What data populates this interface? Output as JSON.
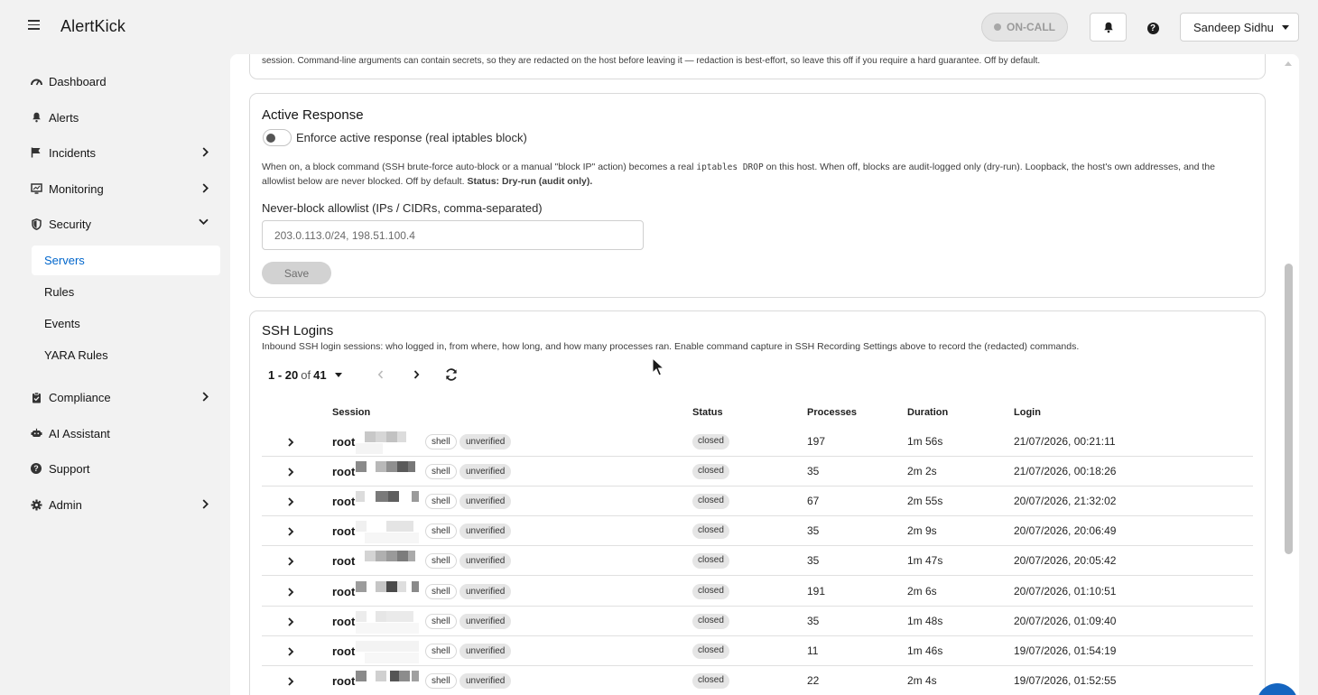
{
  "app": {
    "title": "AlertKick"
  },
  "header": {
    "oncall_label": "ON-CALL",
    "user_name": "Sandeep Sidhu",
    "icons": [
      "hamburger-menu-icon",
      "bell-icon",
      "help-icon",
      "caret-down-icon"
    ]
  },
  "sidebar": {
    "items": [
      {
        "label": "Dashboard",
        "icon": "dashboard-icon"
      },
      {
        "label": "Alerts",
        "icon": "bell-icon"
      },
      {
        "label": "Incidents",
        "icon": "flag-icon",
        "expandable": true
      },
      {
        "label": "Monitoring",
        "icon": "monitor-icon",
        "expandable": true
      },
      {
        "label": "Security",
        "icon": "shield-icon",
        "expanded": true
      },
      {
        "label": "Compliance",
        "icon": "clipboard-icon",
        "expandable": true
      },
      {
        "label": "AI Assistant",
        "icon": "robot-icon"
      },
      {
        "label": "Support",
        "icon": "question-icon"
      },
      {
        "label": "Admin",
        "icon": "gear-icon",
        "expandable": true
      }
    ],
    "security_sub": [
      {
        "label": "Servers",
        "active": true
      },
      {
        "label": "Rules"
      },
      {
        "label": "Events"
      },
      {
        "label": "YARA Rules"
      }
    ]
  },
  "top_note": "session. Command-line arguments can contain secrets, so they are redacted on the host before leaving it — redaction is best-effort, so leave this off if you require a hard guarantee. Off by default.",
  "active_response": {
    "title": "Active Response",
    "toggle_label": "Enforce active response (real iptables block)",
    "toggle_on": false,
    "desc_part1": "When on, a block command (SSH brute-force auto-block or a manual \"block IP\" action) becomes a real ",
    "desc_code": "iptables DROP",
    "desc_part2": " on this host. When off, blocks are audit-logged only (dry-run). Loopback, the host's own addresses, and the allowlist below are never blocked. Off by default. ",
    "desc_status": "Status: Dry-run (audit only).",
    "allowlist_label": "Never-block allowlist (IPs / CIDRs, comma-separated)",
    "allowlist_value": "203.0.113.0/24, 198.51.100.4",
    "save_label": "Save"
  },
  "ssh_logins": {
    "title": "SSH Logins",
    "subtitle": "Inbound SSH login sessions: who logged in, from where, how long, and how many processes ran. Enable command capture in SSH Recording Settings above to record the (redacted) commands.",
    "pagination": {
      "range": "1 - 20",
      "of_label": "of",
      "total": "41"
    },
    "columns": {
      "session": "Session",
      "status": "Status",
      "processes": "Processes",
      "duration": "Duration",
      "login": "Login"
    },
    "rows": [
      {
        "user": "root",
        "type": "shell",
        "verification": "unverified",
        "status": "closed",
        "processes": "197",
        "duration": "1m 56s",
        "login": "21/07/2026, 00:21:11"
      },
      {
        "user": "root",
        "type": "shell",
        "verification": "unverified",
        "status": "closed",
        "processes": "35",
        "duration": "2m 2s",
        "login": "21/07/2026, 00:18:26"
      },
      {
        "user": "root",
        "type": "shell",
        "verification": "unverified",
        "status": "closed",
        "processes": "67",
        "duration": "2m 55s",
        "login": "20/07/2026, 21:32:02"
      },
      {
        "user": "root",
        "type": "shell",
        "verification": "unverified",
        "status": "closed",
        "processes": "35",
        "duration": "2m 9s",
        "login": "20/07/2026, 20:06:49"
      },
      {
        "user": "root",
        "type": "shell",
        "verification": "unverified",
        "status": "closed",
        "processes": "35",
        "duration": "1m 47s",
        "login": "20/07/2026, 20:05:42"
      },
      {
        "user": "root",
        "type": "shell",
        "verification": "unverified",
        "status": "closed",
        "processes": "191",
        "duration": "2m 6s",
        "login": "20/07/2026, 01:10:51"
      },
      {
        "user": "root",
        "type": "shell",
        "verification": "unverified",
        "status": "closed",
        "processes": "35",
        "duration": "1m 48s",
        "login": "20/07/2026, 01:09:40"
      },
      {
        "user": "root",
        "type": "shell",
        "verification": "unverified",
        "status": "closed",
        "processes": "11",
        "duration": "1m 46s",
        "login": "19/07/2026, 01:54:19"
      },
      {
        "user": "root",
        "type": "shell",
        "verification": "unverified",
        "status": "closed",
        "processes": "22",
        "duration": "2m 4s",
        "login": "19/07/2026, 01:52:55"
      }
    ]
  },
  "colors": {
    "accent": "#0066cc",
    "fab": "#1565c0",
    "background": "#f2f2f2"
  }
}
